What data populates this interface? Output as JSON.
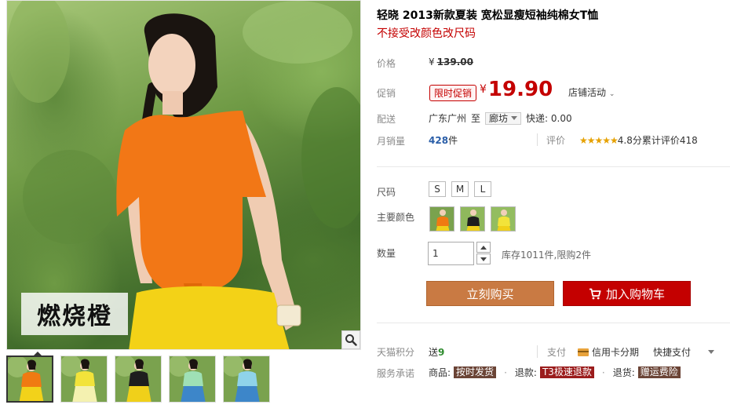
{
  "gallery": {
    "label": "燃烧橙",
    "zoom_icon": "magnifier-icon",
    "thumbnails": [
      {
        "shirt": "#f07a12",
        "skirt": "#f2d21a"
      },
      {
        "shirt": "#f2e33a",
        "skirt": "#f4f1b0"
      },
      {
        "shirt": "#1e1e1e",
        "skirt": "#f0d01a"
      },
      {
        "shirt": "#9fe0b5",
        "skirt": "#3d86c9"
      },
      {
        "shirt": "#8fd3ea",
        "skirt": "#3d86c9"
      }
    ]
  },
  "product": {
    "title": "轻晓 2013新款夏装 宽松显瘦短袖纯棉女T恤",
    "subtitle": "不接受改颜色改尺码"
  },
  "price": {
    "label": "价格",
    "currency": "¥",
    "original": "139.00"
  },
  "promo": {
    "label": "促销",
    "badge": "限时促销",
    "currency": "¥",
    "price": "19.90",
    "store_activity": "店铺活动"
  },
  "shipping": {
    "label": "配送",
    "from": "广东广州",
    "to_word": "至",
    "destination": "廊坊",
    "fee": "快递: 0.00"
  },
  "sales": {
    "label": "月销量",
    "count": "428",
    "unit": "件",
    "rating_label": "评价",
    "stars": "★★★★★",
    "score": "4.8分",
    "review_text": "累计评价418"
  },
  "options": {
    "size_label": "尺码",
    "sizes": [
      "S",
      "M",
      "L"
    ],
    "color_label": "主要颜色",
    "colors": [
      {
        "shirt": "#f07a12",
        "bg": "#7aa24e"
      },
      {
        "shirt": "#1e1e1e",
        "bg": "#8fb85c"
      },
      {
        "shirt": "#f2e33a",
        "bg": "#93bd60"
      }
    ],
    "qty_label": "数量",
    "qty_value": "1",
    "stock_text": "库存1011件,限购2件"
  },
  "actions": {
    "buy_now": "立刻购买",
    "add_to_cart": "加入购物车"
  },
  "footer": {
    "points_label": "天猫积分",
    "points_prefix": "送",
    "points_value": "9",
    "pay_label": "支付",
    "pay_credit": "信用卡分期",
    "pay_quick": "快捷支付",
    "promise_label": "服务承诺",
    "promise_goods": "商品:",
    "promise_goods_tag": "按时发货",
    "promise_refund": "退款:",
    "promise_refund_tag": "T3极速退款",
    "promise_return": "退货:",
    "promise_return_tag": "赠运费险"
  }
}
